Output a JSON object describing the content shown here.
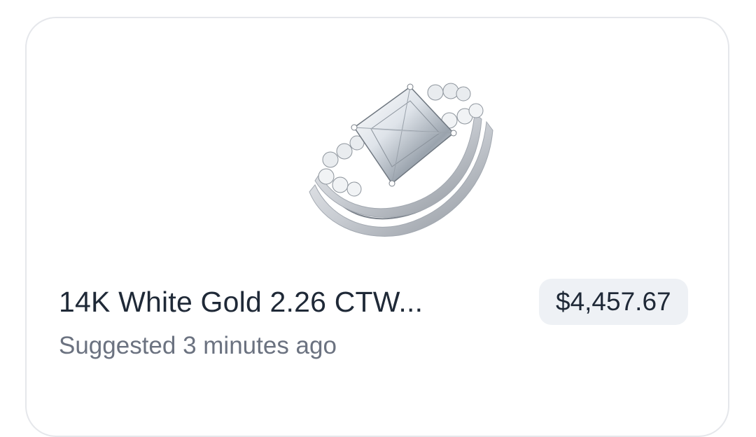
{
  "card": {
    "title": "14K White Gold 2.26 CTW...",
    "subtitle": "Suggested 3 minutes ago",
    "price": "$4,457.67"
  },
  "image": {
    "icon": "diamond-ring-product-image"
  }
}
